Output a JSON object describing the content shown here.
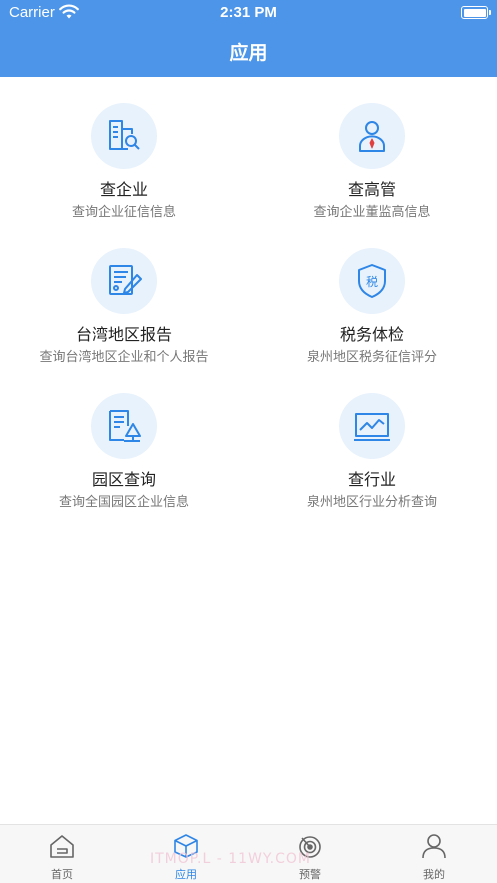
{
  "status_bar": {
    "carrier": "Carrier",
    "time": "2:31 PM"
  },
  "header": {
    "title": "应用"
  },
  "apps": [
    {
      "title": "查企业",
      "subtitle": "查询企业征信信息",
      "icon": "building-search-icon"
    },
    {
      "title": "查高管",
      "subtitle": "查询企业董监高信息",
      "icon": "executive-person-icon"
    },
    {
      "title": "台湾地区报告",
      "subtitle": "查询台湾地区企业和个人报告",
      "icon": "report-edit-icon"
    },
    {
      "title": "税务体检",
      "subtitle": "泉州地区税务征信评分",
      "icon": "tax-shield-icon"
    },
    {
      "title": "园区查询",
      "subtitle": "查询全国园区企业信息",
      "icon": "park-document-icon"
    },
    {
      "title": "查行业",
      "subtitle": "泉州地区行业分析查询",
      "icon": "industry-chart-icon"
    }
  ],
  "tabbar": {
    "tabs": [
      {
        "label": "首页",
        "icon": "home-icon"
      },
      {
        "label": "应用",
        "icon": "cube-icon",
        "active": true
      },
      {
        "label": "预警",
        "icon": "radar-icon"
      },
      {
        "label": "我的",
        "icon": "person-icon"
      }
    ]
  },
  "watermark": "ITMOP.L - 11WY.COM",
  "colors": {
    "primary": "#4c95e8",
    "icon_blue": "#2e86e6",
    "icon_bg": "#e8f2fc",
    "subtitle": "#777777"
  }
}
